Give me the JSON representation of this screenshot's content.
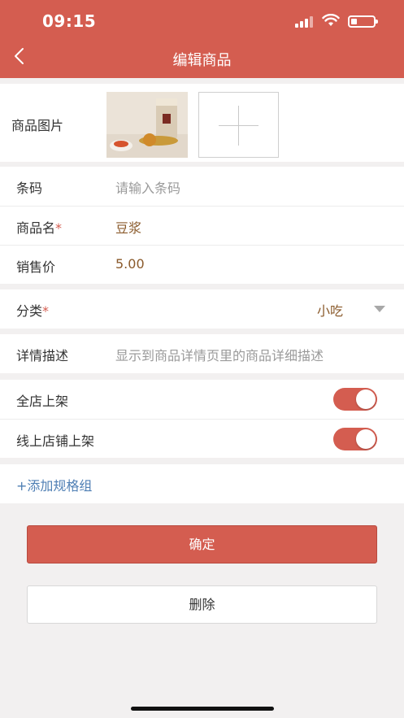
{
  "status_bar": {
    "time": "09:15"
  },
  "nav": {
    "title": "编辑商品"
  },
  "photo": {
    "label": "商品图片"
  },
  "fields": {
    "barcode": {
      "label": "条码",
      "placeholder": "请输入条码"
    },
    "name": {
      "label": "商品名",
      "required_mark": "*",
      "value": "豆浆"
    },
    "price": {
      "label": "销售价",
      "value": "5.00"
    }
  },
  "category": {
    "label": "分类",
    "required_mark": "*",
    "value": "小吃"
  },
  "description": {
    "label": "详情描述",
    "placeholder": "显示到商品详情页里的商品详细描述"
  },
  "toggles": [
    {
      "label": "全店上架",
      "on": true
    },
    {
      "label": "线上店铺上架",
      "on": true
    }
  ],
  "add_spec_group": "+添加规格组",
  "buttons": {
    "confirm": "确定",
    "delete": "删除"
  },
  "colors": {
    "accent": "#d45d50",
    "value_text": "#8a5a2b",
    "link": "#4f7fb4"
  }
}
